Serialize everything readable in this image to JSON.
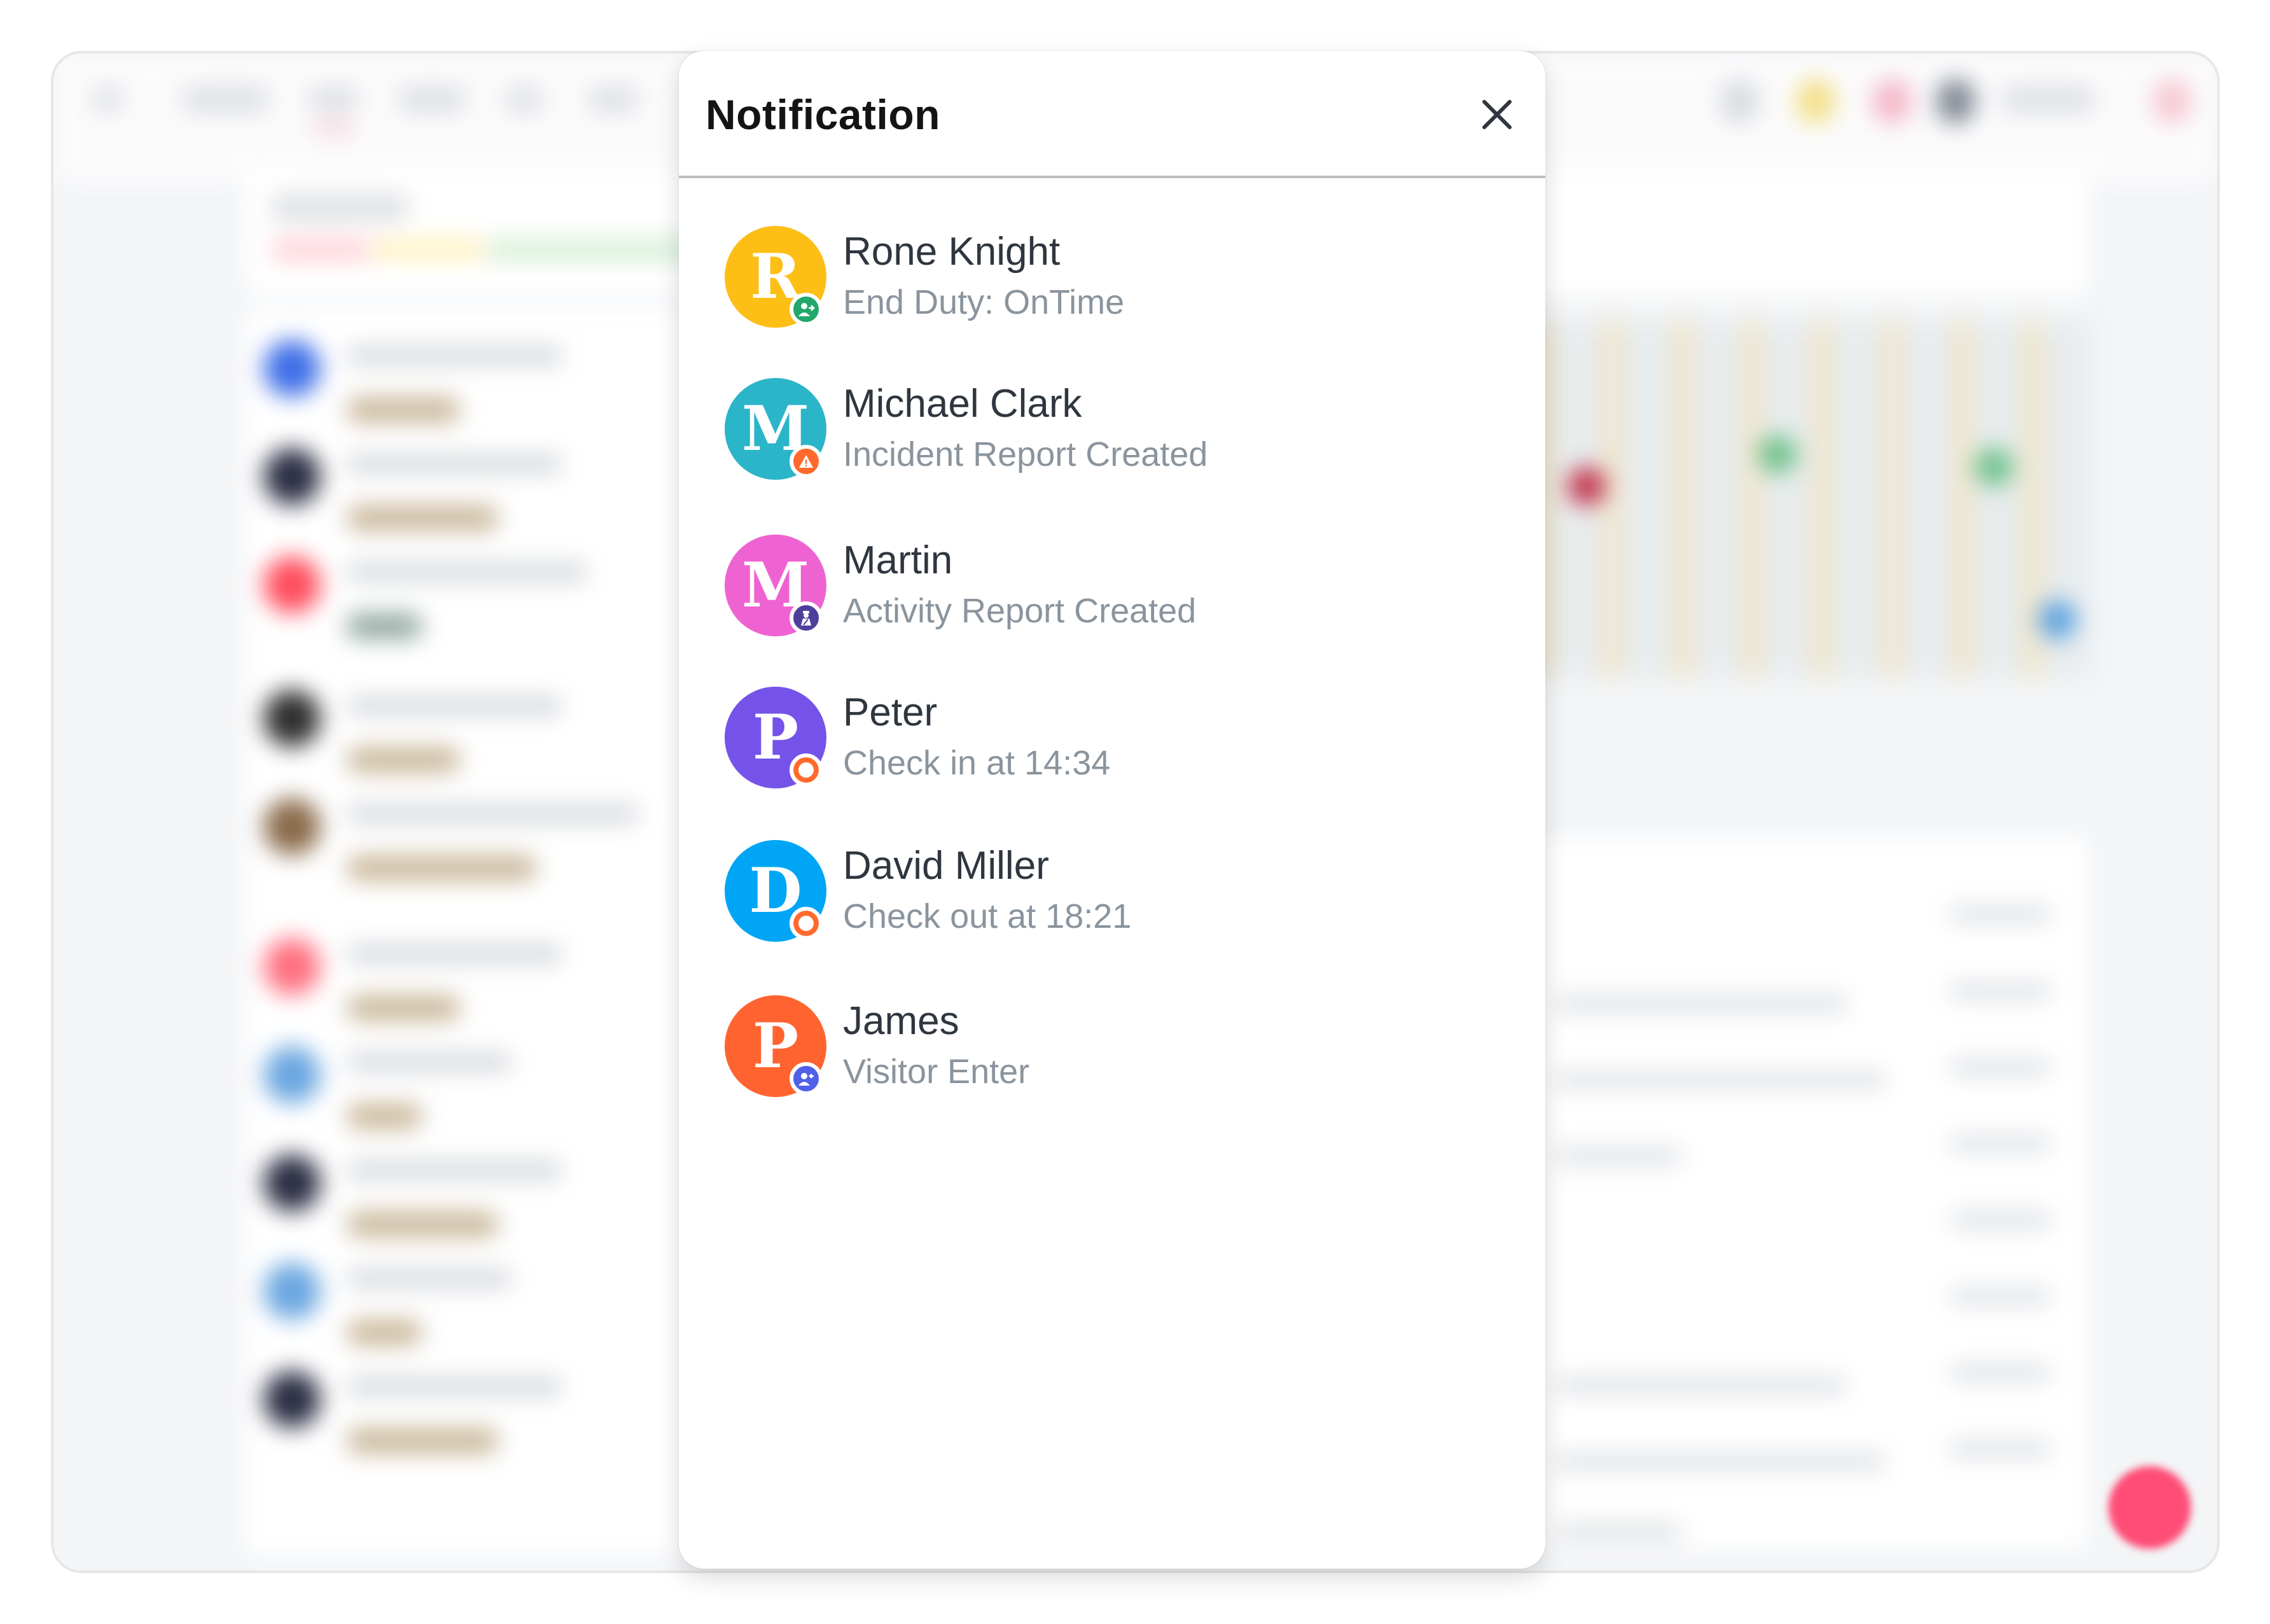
{
  "modal": {
    "title": "Notification",
    "close_icon": "close-icon"
  },
  "notifications": [
    {
      "name": "Rone Knight",
      "message": "End Duty: OnTime",
      "initial": "R",
      "avatar_color": "#FDBE16",
      "badge_icon": "end-duty-icon",
      "badge_color": "#22A86A"
    },
    {
      "name": "Michael Clark",
      "message": "Incident Report Created",
      "initial": "M",
      "avatar_color": "#2BB5C9",
      "badge_icon": "warning-icon",
      "badge_color": "#FF6A2C"
    },
    {
      "name": "Martin",
      "message": "Activity Report Created",
      "initial": "M",
      "avatar_color": "#EE63D1",
      "badge_icon": "guard-icon",
      "badge_color": "#4F3F9D"
    },
    {
      "name": "Peter",
      "message": "Check in at 14:34",
      "initial": "P",
      "avatar_color": "#7553E8",
      "badge_icon": "check-in-ring-icon",
      "badge_color": "#FF6A2C"
    },
    {
      "name": "David Miller",
      "message": "Check out at 18:21",
      "initial": "D",
      "avatar_color": "#00A6F5",
      "badge_icon": "check-out-ring-icon",
      "badge_color": "#FF6A2C"
    },
    {
      "name": "James",
      "message": "Visitor Enter",
      "initial": "P",
      "avatar_color": "#FF6430",
      "badge_icon": "visitor-icon",
      "badge_color": "#5060E8"
    }
  ],
  "background": {
    "fab_color": "#FF4D76",
    "status_colors": [
      "#FFD4DA",
      "#FFF3C4",
      "#D8F0DA"
    ]
  }
}
